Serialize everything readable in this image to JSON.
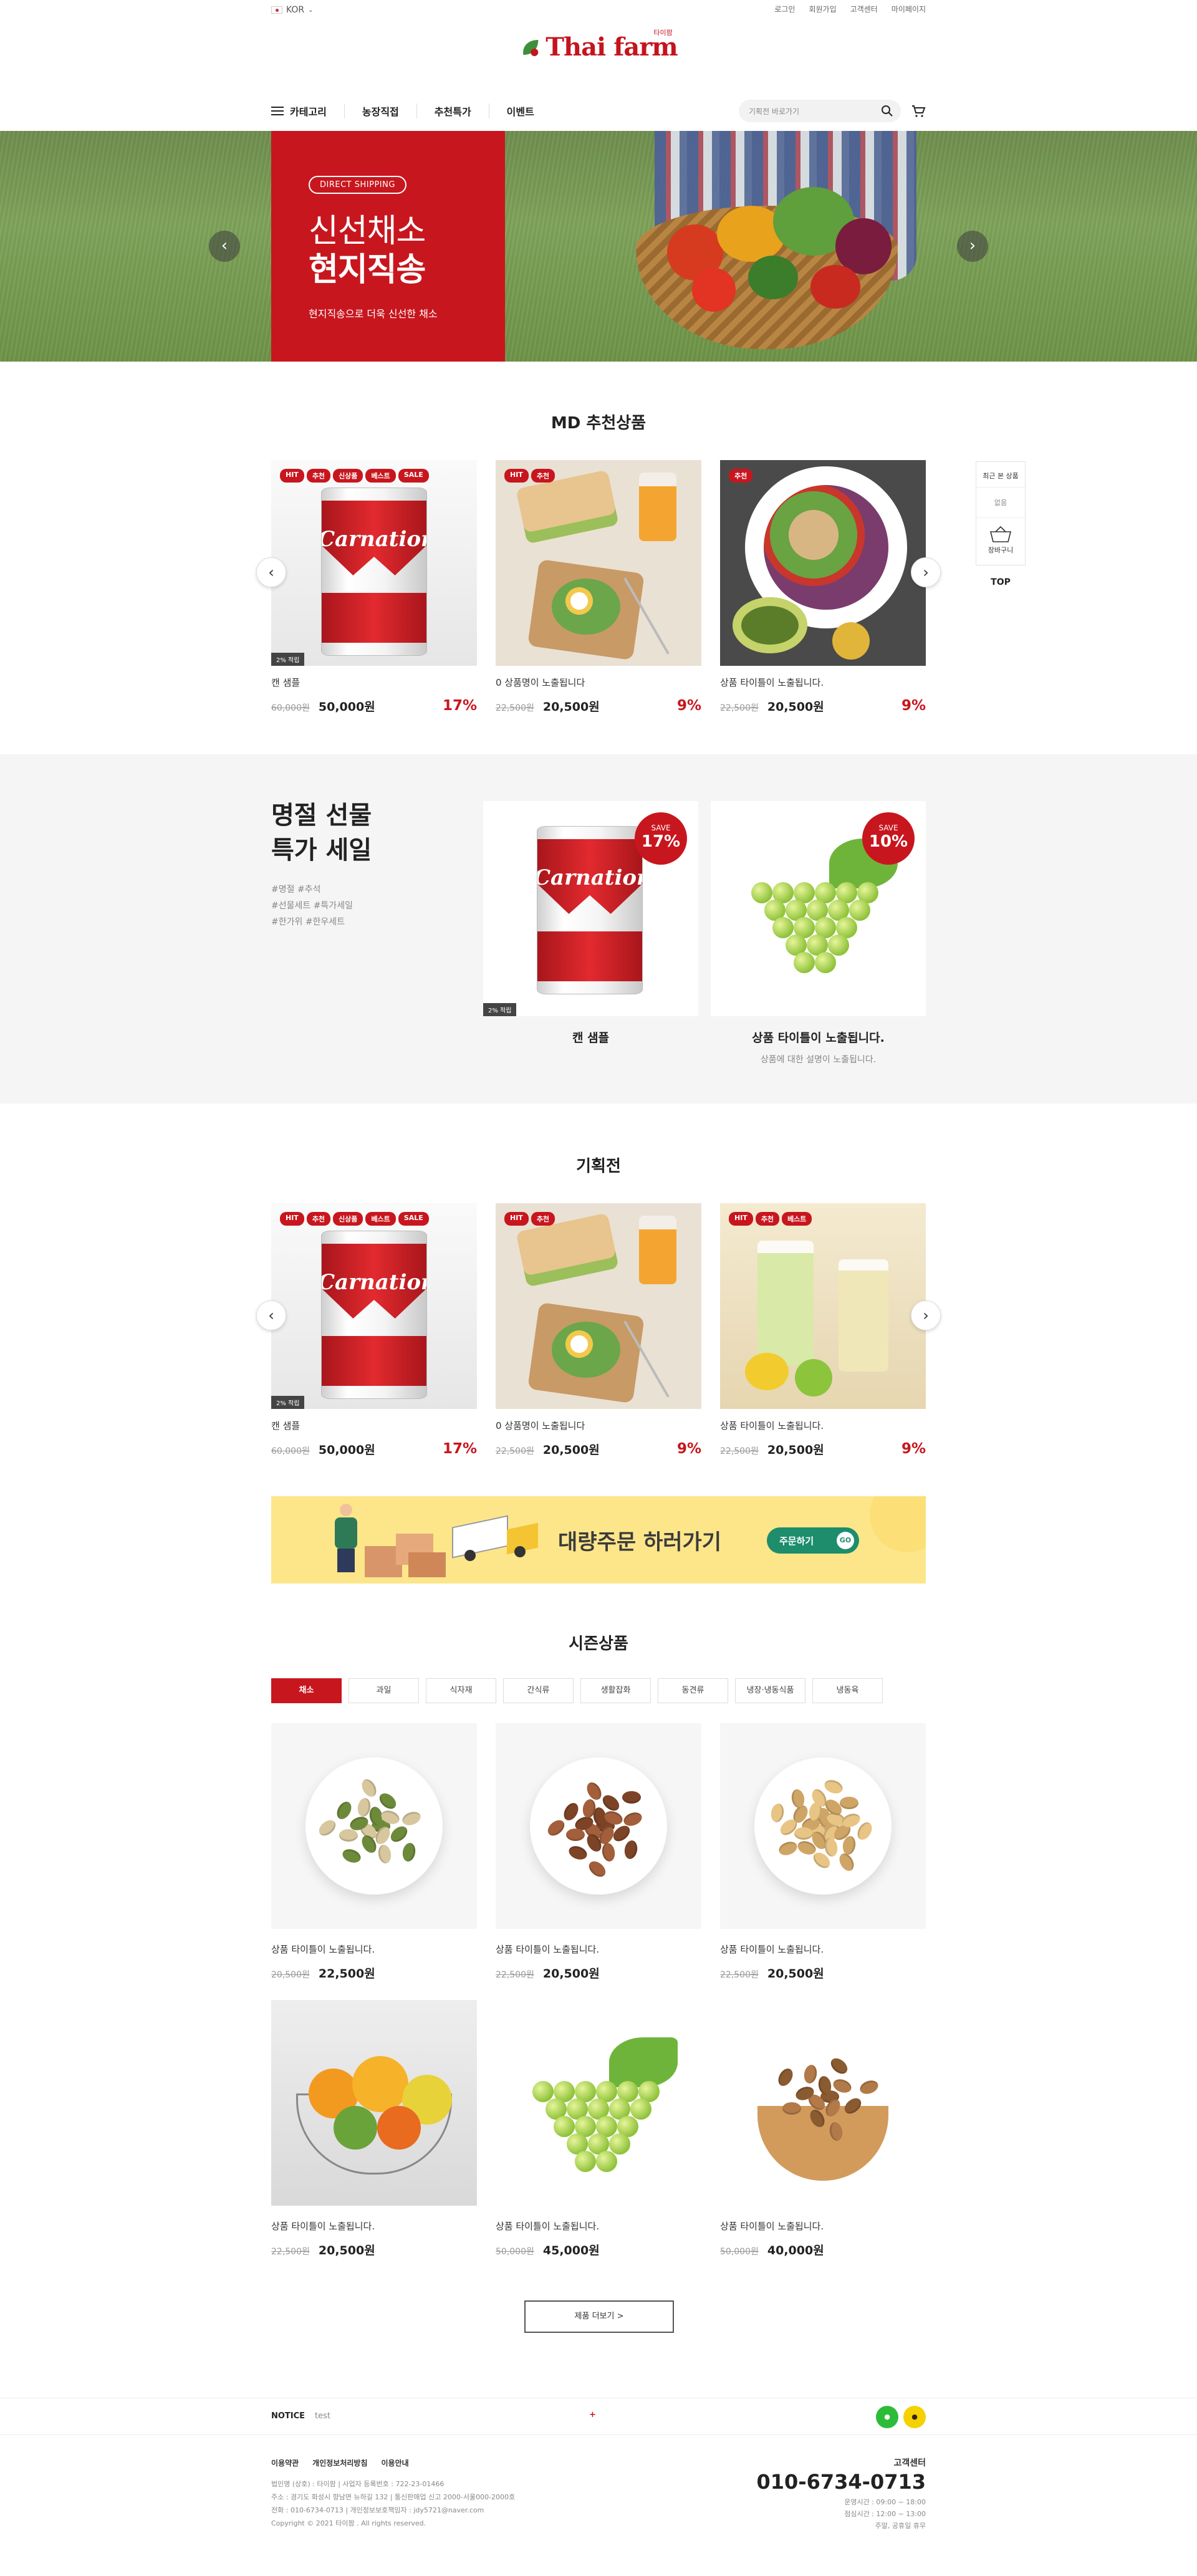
{
  "header": {
    "lang": "KOR",
    "links": [
      "로그인",
      "회원가입",
      "고객센터",
      "마이페이지"
    ],
    "logo_main": "Thai farm",
    "logo_kr": "타이팜"
  },
  "nav": {
    "category": "카테고리",
    "items": [
      "농장직접",
      "추천특가",
      "이벤트"
    ],
    "search_placeholder": "기획전 바로가기"
  },
  "hero": {
    "badge": "DIRECT SHIPPING",
    "title1": "신선채소",
    "title2": "현지직송",
    "sub": "현지직송으로 더욱 신선한 채소"
  },
  "md": {
    "title": "MD 추천상품",
    "products": [
      {
        "tags": [
          "HIT",
          "추천",
          "신상품",
          "베스트",
          "SALE"
        ],
        "badge": "2% 적립",
        "name": "캔 샘플",
        "old": "60,000원",
        "price": "50,000원",
        "disc": "17%",
        "img": "can"
      },
      {
        "tags": [
          "HIT",
          "추천"
        ],
        "name": "0 상품명이 노출됩니다",
        "old": "22,500원",
        "price": "20,500원",
        "disc": "9%",
        "img": "sandwich"
      },
      {
        "tags": [
          "추천"
        ],
        "name": "상품 타이틀이 노출됩니다.",
        "old": "22,500원",
        "price": "20,500원",
        "disc": "9%",
        "img": "salad"
      }
    ]
  },
  "quick": {
    "recent": "최근 본 상품",
    "none": "없음",
    "cart": "장바구니",
    "top": "TOP"
  },
  "gift": {
    "title1": "명절 선물",
    "title2": "특가 세일",
    "tags": [
      "#명절 #추석",
      "#선물세트 #특가세일",
      "#한가위 #한우세트"
    ],
    "items": [
      {
        "save_label": "SAVE",
        "save": "17%",
        "badge": "2% 적립",
        "name": "캔 샘플",
        "desc": "",
        "img": "can"
      },
      {
        "save_label": "SAVE",
        "save": "10%",
        "name": "상품 타이틀이 노출됩니다.",
        "desc": "상품에 대한 설명이 노출됩니다.",
        "img": "grape"
      }
    ]
  },
  "plan": {
    "title": "기획전",
    "products": [
      {
        "tags": [
          "HIT",
          "추천",
          "신상품",
          "베스트",
          "SALE"
        ],
        "badge": "2% 적립",
        "name": "캔 샘플",
        "old": "60,000원",
        "price": "50,000원",
        "disc": "17%",
        "img": "can"
      },
      {
        "tags": [
          "HIT",
          "추천"
        ],
        "name": "0 상품명이 노출됩니다",
        "old": "22,500원",
        "price": "20,500원",
        "disc": "9%",
        "img": "sandwich"
      },
      {
        "tags": [
          "HIT",
          "추천",
          "베스트"
        ],
        "name": "상품 타이틀이 노출됩니다.",
        "old": "22,500원",
        "price": "20,500원",
        "disc": "9%",
        "img": "drink"
      }
    ]
  },
  "banner": {
    "text": "대량주문 하러가기",
    "button": "주문하기",
    "button_icon": "GO"
  },
  "season": {
    "title": "시즌상품",
    "tabs": [
      "채소",
      "과일",
      "식자재",
      "간식류",
      "생활잡화",
      "동견류",
      "냉장·냉동식품",
      "냉동육"
    ],
    "products": [
      {
        "name": "상품 타이틀이 노출됩니다.",
        "old": "20,500원",
        "price": "22,500원",
        "img": "pistachio"
      },
      {
        "name": "상품 타이틀이 노출됩니다.",
        "old": "22,500원",
        "price": "20,500원",
        "img": "almond"
      },
      {
        "name": "상품 타이틀이 노출됩니다.",
        "old": "22,500원",
        "price": "20,500원",
        "img": "peanut"
      },
      {
        "name": "상품 타이틀이 노출됩니다.",
        "old": "22,500원",
        "price": "20,500원",
        "img": "fruit"
      },
      {
        "name": "상품 타이틀이 노출됩니다.",
        "old": "50,000원",
        "price": "45,000원",
        "img": "grape"
      },
      {
        "name": "상품 타이틀이 노출됩니다.",
        "old": "50,000원",
        "price": "40,000원",
        "img": "walnut"
      }
    ],
    "more": "제품 더보기 >"
  },
  "notice": {
    "label": "NOTICE",
    "text": "test",
    "plus": "+"
  },
  "footer": {
    "links": [
      "이용약관",
      "개인정보처리방침",
      "이용안내"
    ],
    "info": [
      "법인명 (상호) : 타이팜   |   사업자 등록번호 : 722-23-01466",
      "주소 : 경기도 화성시 향남면 뉴하길 132   |   통신판매업 신고 2000-서울000-2000호",
      "전화 : 010-6734-0713   |   개인정보보호책임자 : jdy5721@naver.com",
      "Copyright © 2021 타이팜 . All rights reserved."
    ],
    "cs_label": "고객센터",
    "cs_phone": "010-6734-0713",
    "cs_hours": [
      "운영시간 : 09:00 ~ 18:00",
      "점심시간 : 12:00 ~ 13:00",
      "주말, 공휴일 휴무"
    ]
  },
  "colors": {
    "accent": "#c8161e",
    "banner": "#fde68a",
    "banner_btn": "#1d8d6c"
  }
}
